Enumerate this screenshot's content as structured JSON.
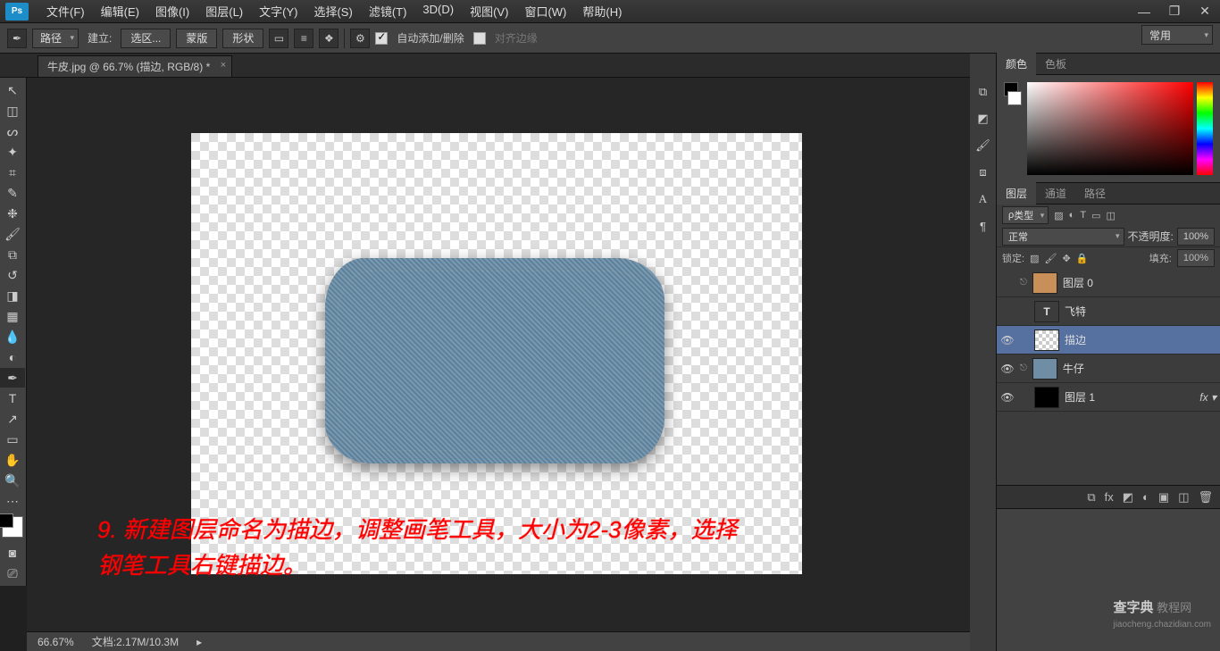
{
  "app": {
    "logo": "Ps"
  },
  "menu": [
    "文件(F)",
    "编辑(E)",
    "图像(I)",
    "图层(L)",
    "文字(Y)",
    "选择(S)",
    "滤镜(T)",
    "3D(D)",
    "视图(V)",
    "窗口(W)",
    "帮助(H)"
  ],
  "win": {
    "min": "—",
    "max": "❐",
    "close": "✕"
  },
  "options": {
    "path_mode": "路径",
    "build": "建立:",
    "btn_sel": "选区...",
    "btn_mask": "蒙版",
    "btn_shape": "形状",
    "auto_add": "自动添加/删除",
    "align": "对齐边缘",
    "workspace": "常用"
  },
  "tab": {
    "title": "牛皮.jpg @ 66.7% (描边, RGB/8) *"
  },
  "tools_names": [
    "move",
    "marquee",
    "lasso",
    "quick-select",
    "crop",
    "eyedropper",
    "spot-heal",
    "brush",
    "clone",
    "history-brush",
    "eraser",
    "gradient",
    "blur",
    "dodge",
    "pen",
    "type",
    "path-select",
    "shape",
    "hand",
    "zoom"
  ],
  "status": {
    "zoom": "66.67%",
    "doc": "文档:2.17M/10.3M"
  },
  "color_panel": {
    "tab1": "颜色",
    "tab2": "色板"
  },
  "layers_panel": {
    "tab1": "图层",
    "tab2": "通道",
    "tab3": "路径",
    "filter": "类型",
    "blend": "正常",
    "opacity_lbl": "不透明度:",
    "opacity": "100%",
    "lock_lbl": "锁定:",
    "fill_lbl": "填充:",
    "fill": "100%",
    "layers": [
      {
        "name": "图层 0",
        "thumb": "#c89058",
        "visible": false,
        "link": true
      },
      {
        "name": "飞特",
        "type": "T",
        "visible": false
      },
      {
        "name": "描边",
        "thumb": "checker",
        "visible": true,
        "selected": true
      },
      {
        "name": "牛仔",
        "thumb": "#6f8ea5",
        "visible": true,
        "link": true
      },
      {
        "name": "图层 1",
        "thumb": "#000",
        "visible": true,
        "fx": true
      }
    ]
  },
  "annotation": {
    "line1": "9. 新建图层命名为描边，调整画笔工具，大小为2-3像素，选择",
    "line2": "钢笔工具右键描边。"
  },
  "watermark": {
    "big": "查字典",
    "small": " 教程网",
    "url": "jiaocheng.chazidian.com"
  }
}
